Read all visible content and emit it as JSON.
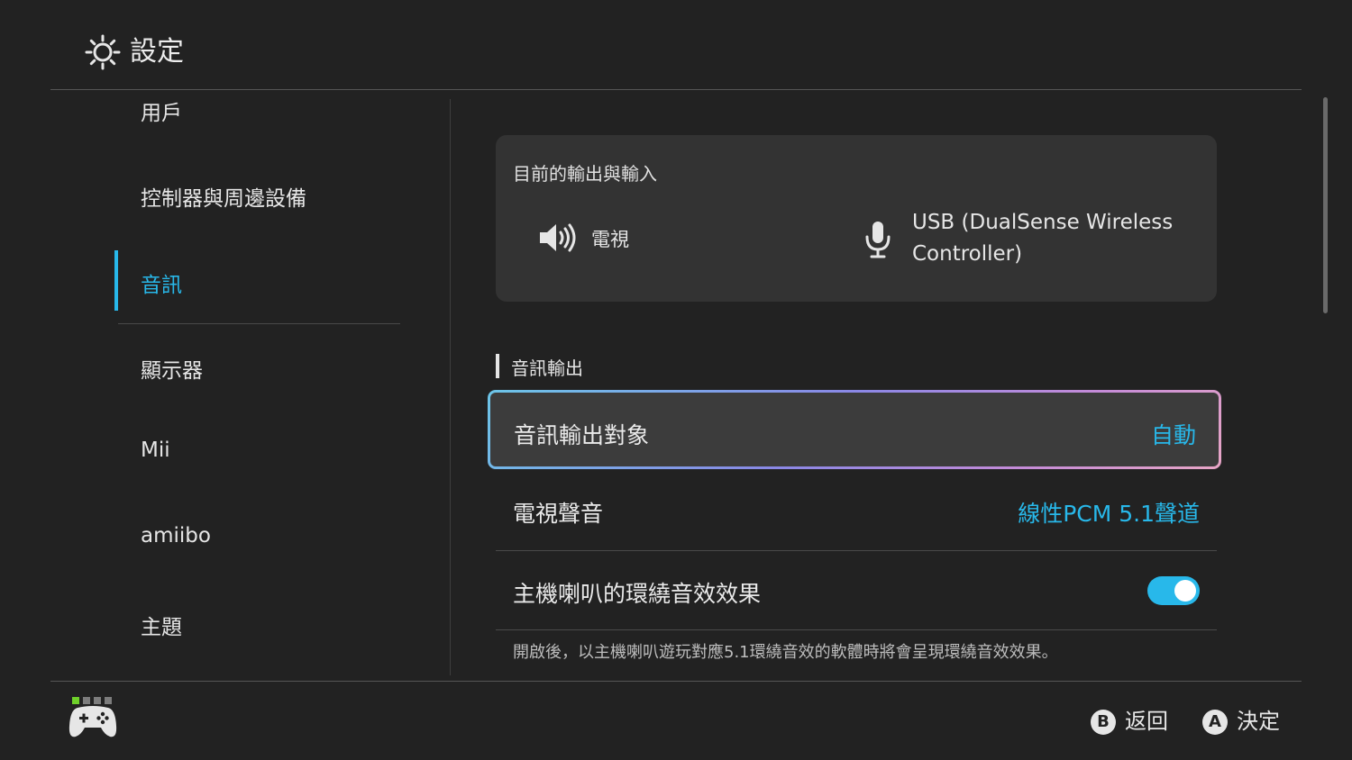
{
  "header": {
    "title": "設定",
    "icon": "gear-icon"
  },
  "sidebar": {
    "items": [
      {
        "label": "用戶"
      },
      {
        "label": "控制器與周邊設備"
      },
      {
        "label": "音訊",
        "active": true
      },
      {
        "label": "顯示器"
      },
      {
        "label": "Mii"
      },
      {
        "label": "amiibo"
      },
      {
        "label": "主題"
      }
    ]
  },
  "io_card": {
    "title": "目前的輸出與輸入",
    "output_label": "電視",
    "output_icon": "speaker-icon",
    "input_label": "USB (DualSense Wireless Controller)",
    "input_icon": "microphone-icon"
  },
  "section": {
    "title": "音訊輸出"
  },
  "settings": [
    {
      "label": "音訊輸出對象",
      "value": "自動",
      "selected": true
    },
    {
      "label": "電視聲音",
      "value": "線性PCM 5.1聲道"
    },
    {
      "label": "主機喇叭的環繞音效效果",
      "toggle": true
    }
  ],
  "note": "開啟後，以主機喇叭遊玩對應5.1環繞音效的軟體時將會呈現環繞音效效果。",
  "footer": {
    "back_button": {
      "glyph": "B",
      "label": "返回"
    },
    "confirm_button": {
      "glyph": "A",
      "label": "決定"
    },
    "controller_icon": "controller-icon",
    "player_indicator": [
      true,
      false,
      false,
      false
    ]
  },
  "colors": {
    "accent": "#28b8ea",
    "background": "#222222",
    "card": "#333333",
    "indicator_active": "#6fd12a"
  }
}
